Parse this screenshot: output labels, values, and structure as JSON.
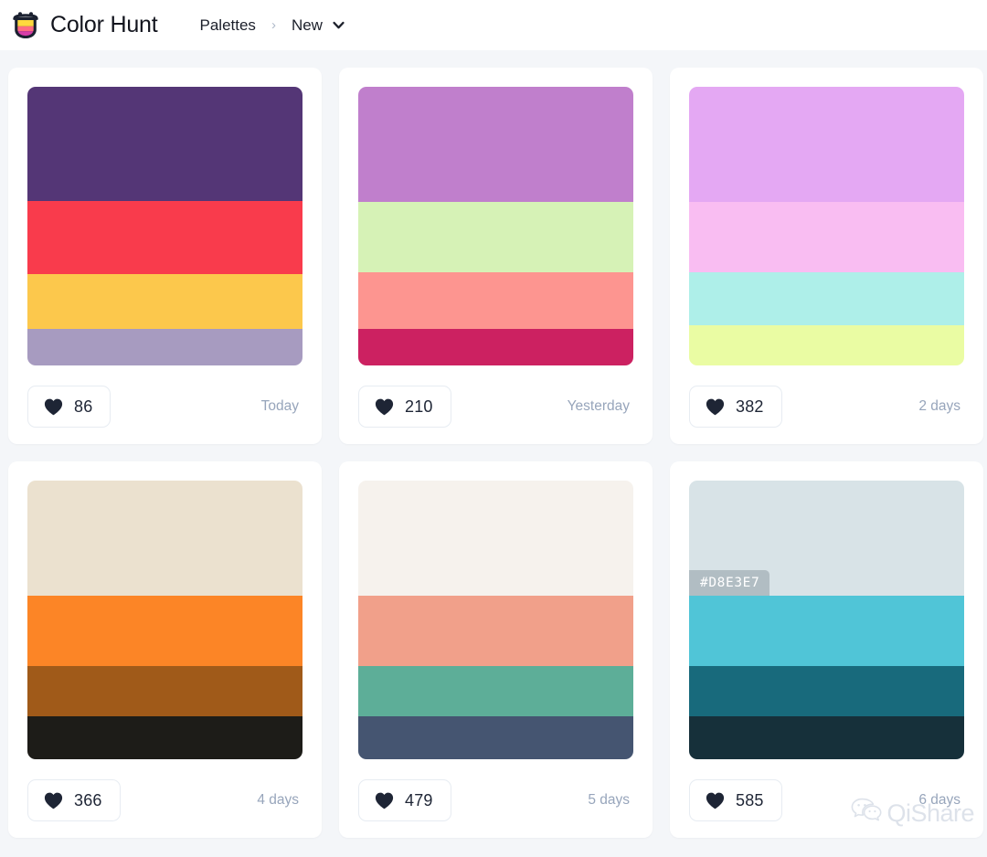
{
  "header": {
    "logo_icon": "colorhunt-cup-logo-icon",
    "logo_colors": {
      "body": "#1b2130",
      "top_stripe": "#ffd93d",
      "mid_stripe": "#ff6b81",
      "bottom_stripe": "#d63da8"
    },
    "brand": "Color Hunt",
    "breadcrumb": {
      "root": "Palettes",
      "separator": "›",
      "current": "New",
      "chevron_icon": "chevron-down-icon"
    }
  },
  "theme": {
    "page_background": "#f4f6f9",
    "card_background": "#ffffff",
    "text_dark": "#1e2535",
    "text_muted": "#97a5bb",
    "border": "#e7ecf2"
  },
  "main": {
    "palettes": [
      {
        "id": "palette-1",
        "colors": [
          "#543676",
          "#f93b4c",
          "#fcc84c",
          "#a79bc0"
        ],
        "heights": [
          125,
          80,
          60,
          40
        ],
        "likes": "86",
        "date": "Today",
        "heart_icon": "heart-icon",
        "hex_tooltip": null
      },
      {
        "id": "palette-2",
        "colors": [
          "#c07fcc",
          "#d6f2b6",
          "#fd9590",
          "#cc2161"
        ],
        "heights": [
          126,
          77,
          62,
          40
        ],
        "likes": "210",
        "date": "Yesterday",
        "heart_icon": "heart-icon",
        "hex_tooltip": null
      },
      {
        "id": "palette-3",
        "colors": [
          "#e4a8f3",
          "#f9bdf2",
          "#aeefe9",
          "#eafca3"
        ],
        "heights": [
          126,
          77,
          58,
          44
        ],
        "likes": "382",
        "date": "2 days",
        "heart_icon": "heart-icon",
        "hex_tooltip": null
      },
      {
        "id": "palette-4",
        "colors": [
          "#ebe1cf",
          "#fc8526",
          "#a05a19",
          "#1d1c18"
        ],
        "heights": [
          126,
          77,
          55,
          47
        ],
        "likes": "366",
        "date": "4 days",
        "heart_icon": "heart-icon",
        "hex_tooltip": null
      },
      {
        "id": "palette-5",
        "colors": [
          "#f6f2ed",
          "#f1a08a",
          "#5dae98",
          "#455571"
        ],
        "heights": [
          126,
          77,
          55,
          47
        ],
        "likes": "479",
        "date": "5 days",
        "heart_icon": "heart-icon",
        "hex_tooltip": null
      },
      {
        "id": "palette-6",
        "colors": [
          "#d8e3e7",
          "#50c5d7",
          "#186a7c",
          "#16303a"
        ],
        "heights": [
          126,
          77,
          55,
          47
        ],
        "likes": "585",
        "date": "6 days",
        "heart_icon": "heart-icon",
        "hex_tooltip": "#D8E3E7"
      }
    ]
  },
  "watermark": {
    "icon": "wechat-icon",
    "text": "QiShare"
  }
}
